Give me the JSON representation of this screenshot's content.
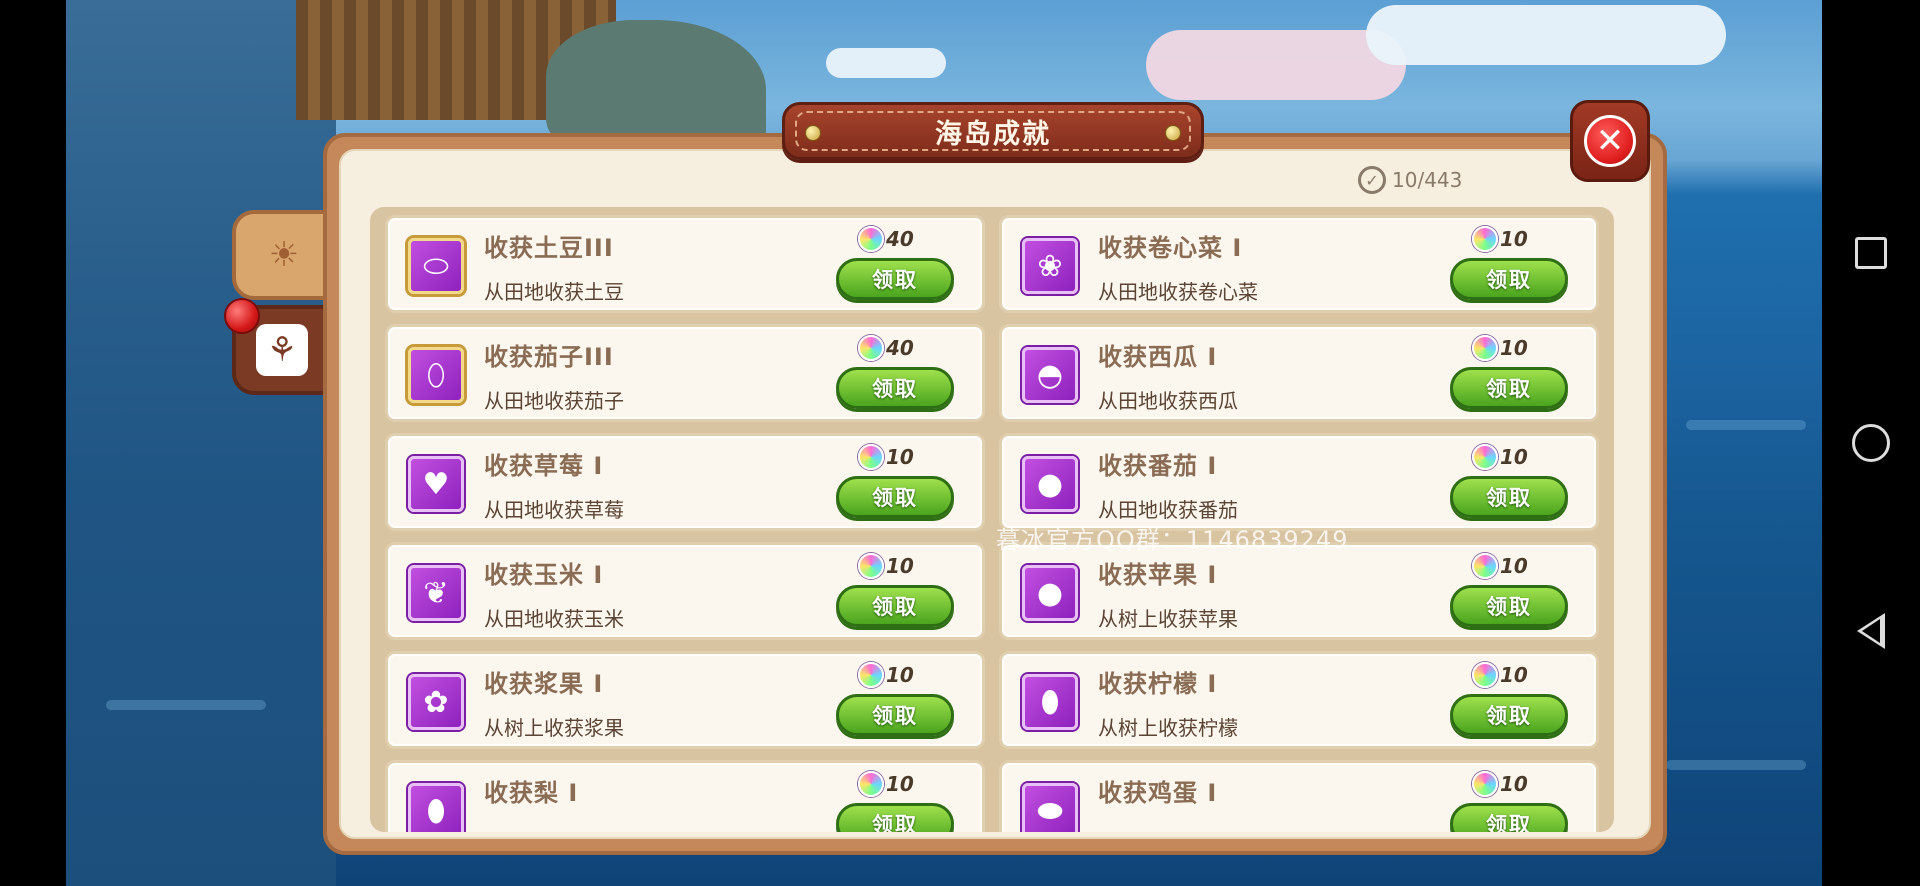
{
  "window": {
    "title": "海岛成就"
  },
  "progress": {
    "text": "10/443"
  },
  "watermark": "暮冰官方QQ群：1146839249",
  "claim_label": "领取",
  "achievements": [
    {
      "title": "收获土豆III",
      "desc": "从田地收获土豆",
      "reward": "40",
      "icon": "potato-icon",
      "glyph": "⬭",
      "tier": "gold"
    },
    {
      "title": "收获卷心菜 I",
      "desc": "从田地收获卷心菜",
      "reward": "10",
      "icon": "cabbage-icon",
      "glyph": "❀",
      "tier": "normal"
    },
    {
      "title": "收获茄子III",
      "desc": "从田地收获茄子",
      "reward": "40",
      "icon": "eggplant-icon",
      "glyph": "⬯",
      "tier": "gold"
    },
    {
      "title": "收获西瓜 I",
      "desc": "从田地收获西瓜",
      "reward": "10",
      "icon": "watermelon-icon",
      "glyph": "◓",
      "tier": "normal"
    },
    {
      "title": "收获草莓 I",
      "desc": "从田地收获草莓",
      "reward": "10",
      "icon": "strawberry-icon",
      "glyph": "♥",
      "tier": "normal"
    },
    {
      "title": "收获番茄 I",
      "desc": "从田地收获番茄",
      "reward": "10",
      "icon": "tomato-icon",
      "glyph": "●",
      "tier": "normal"
    },
    {
      "title": "收获玉米 I",
      "desc": "从田地收获玉米",
      "reward": "10",
      "icon": "corn-icon",
      "glyph": "❦",
      "tier": "normal"
    },
    {
      "title": "收获苹果 I",
      "desc": "从树上收获苹果",
      "reward": "10",
      "icon": "apple-icon",
      "glyph": "●",
      "tier": "normal"
    },
    {
      "title": "收获浆果 I",
      "desc": "从树上收获浆果",
      "reward": "10",
      "icon": "berry-icon",
      "glyph": "✿",
      "tier": "normal"
    },
    {
      "title": "收获柠檬 I",
      "desc": "从树上收获柠檬",
      "reward": "10",
      "icon": "lemon-icon",
      "glyph": "⬮",
      "tier": "normal"
    },
    {
      "title": "收获梨 I",
      "desc": "",
      "reward": "10",
      "icon": "pear-icon",
      "glyph": "⬮",
      "tier": "normal"
    },
    {
      "title": "收获鸡蛋 I",
      "desc": "",
      "reward": "10",
      "icon": "egg-icon",
      "glyph": "⬬",
      "tier": "normal"
    }
  ],
  "side_tabs": [
    {
      "icon": "sun-icon",
      "glyph": "☀",
      "active": false
    },
    {
      "icon": "wheat-icon",
      "glyph": "⚘",
      "active": true
    }
  ],
  "nav": {
    "recent": "recent-apps-icon",
    "home": "home-icon",
    "back": "back-icon"
  }
}
